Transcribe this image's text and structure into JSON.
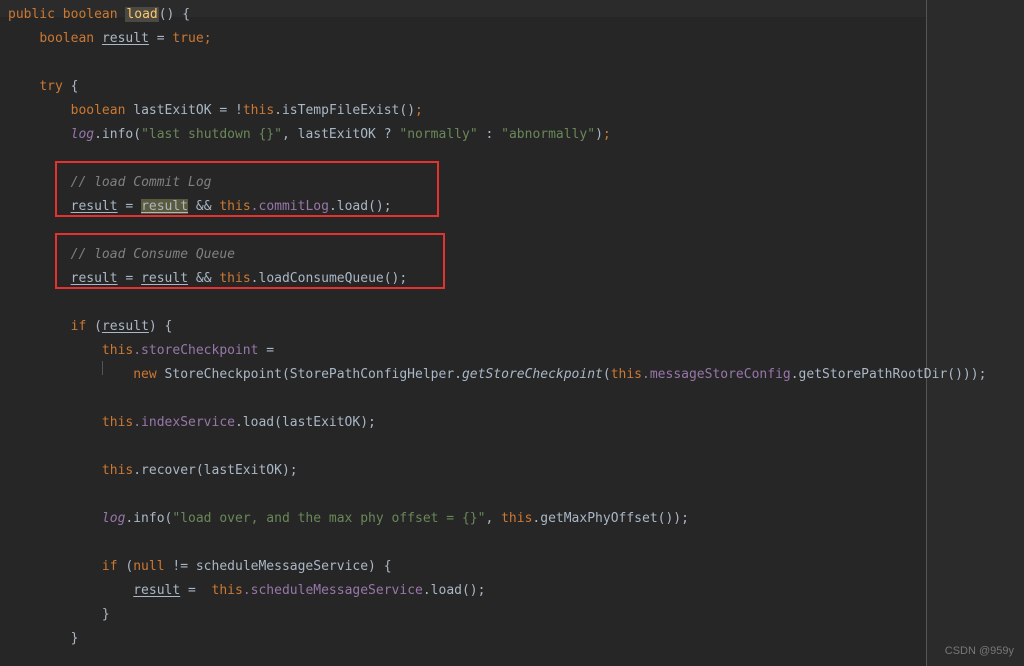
{
  "code": {
    "public": "public",
    "boolean": "boolean",
    "load": "load",
    "result": "result",
    "true": "true",
    "try": "try",
    "lastExitOK": "lastExitOK",
    "this": "this",
    "isTempFileExist": ".isTempFileExist()",
    "log": "log",
    "info": ".info(",
    "str_last_shutdown": "\"last shutdown {}\"",
    "comma_lastExitOK": ", lastExitOK ? ",
    "str_normally": "\"normally\"",
    "colon_sp": " : ",
    "str_abnormally": "\"abnormally\"",
    "close_paren_semi": ");",
    "comment_commit_log": "// load Commit Log",
    "and_this": " && ",
    "commitLog": ".commitLog",
    "load_call": ".load();",
    "comment_consume_queue": "// load Consume Queue",
    "loadConsumeQueue": ".loadConsumeQueue();",
    "if": "if",
    "storeCheckpoint": ".storeCheckpoint",
    "eq": " = ",
    "new": "new",
    "StoreCheckpoint": "StoreCheckpoint",
    "StorePathConfigHelper": "StorePathConfigHelper",
    "getStoreCheckpoint": "getStoreCheckpoint",
    "messageStoreConfig": ".messageStoreConfig",
    "getStorePathRootDir": ".getStorePathRootDir()));",
    "indexService": ".indexService",
    "load_lastExitOK": ".load(lastExitOK);",
    "recover": ".recover(lastExitOK);",
    "str_load_over": "\"load over, and the max phy offset = {}\"",
    "comma_this": ", ",
    "getMaxPhyOffset": ".getMaxPhyOffset());",
    "null": "null",
    "neq": " != ",
    "scheduleMessageService": "scheduleMessageService",
    "sms_field": ".scheduleMessageService",
    "eq_sp": " =  "
  },
  "watermark": "CSDN @959y"
}
